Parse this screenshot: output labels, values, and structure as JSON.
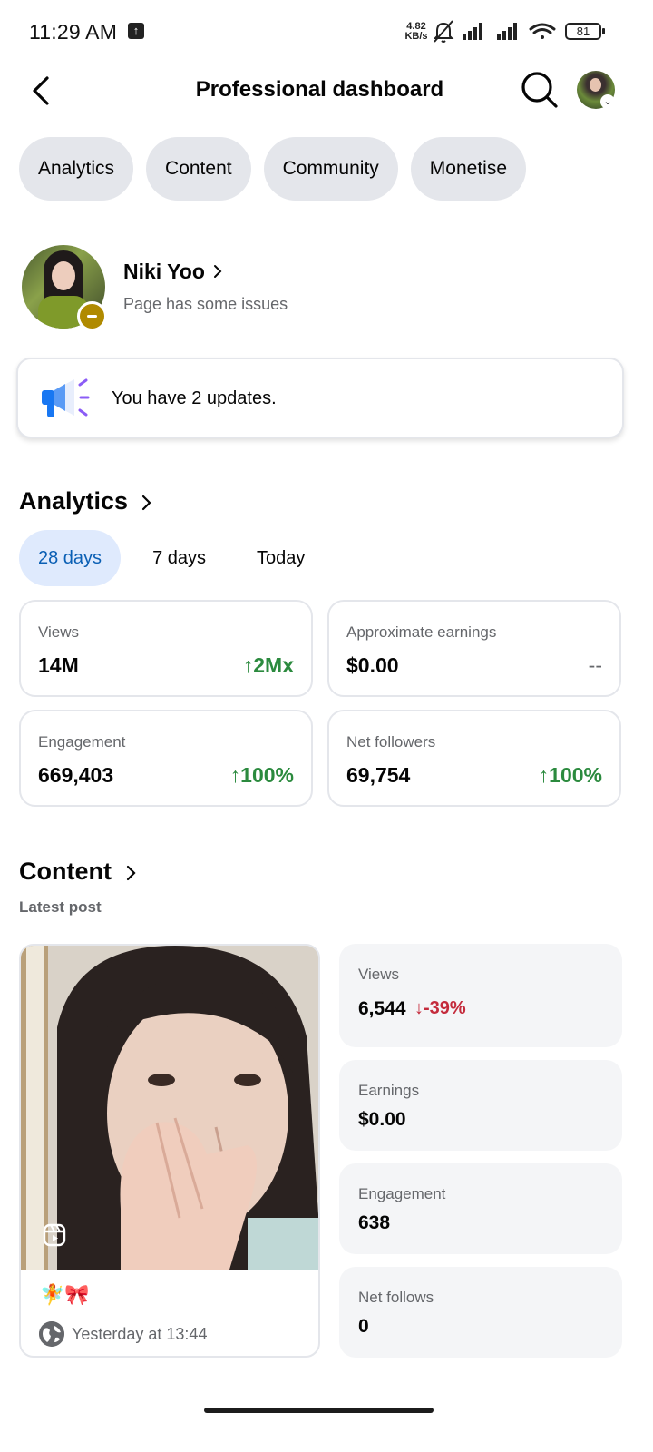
{
  "status_bar": {
    "time": "11:29 AM",
    "net_speed_value": "4.82",
    "net_speed_unit": "KB/s",
    "battery": "81",
    "icons": [
      "upload-icon",
      "mute-icon",
      "signal-icon",
      "signal-icon",
      "wifi-icon",
      "battery-icon"
    ]
  },
  "header": {
    "title": "Professional dashboard",
    "back_icon": "chevron-left-icon",
    "search_icon": "search-icon"
  },
  "top_tabs": [
    "Analytics",
    "Content",
    "Community",
    "Monetise"
  ],
  "profile": {
    "name": "Niki Yoo",
    "status": "Page has some issues"
  },
  "updates": {
    "text": "You have 2 updates."
  },
  "analytics": {
    "title": "Analytics",
    "periods": [
      "28 days",
      "7 days",
      "Today"
    ],
    "active_period": "28 days",
    "metrics": {
      "views": {
        "label": "Views",
        "value": "14M",
        "change": "2Mx",
        "direction": "up"
      },
      "earnings": {
        "label": "Approximate earnings",
        "value": "$0.00",
        "change": "--",
        "direction": "none"
      },
      "engagement": {
        "label": "Engagement",
        "value": "669,403",
        "change": "100%",
        "direction": "up"
      },
      "net_followers": {
        "label": "Net followers",
        "value": "69,754",
        "change": "100%",
        "direction": "up"
      }
    }
  },
  "content": {
    "title": "Content",
    "subtitle": "Latest post",
    "post": {
      "caption_emoji": "🧚🎀",
      "time": "Yesterday at 13:44"
    },
    "stats": {
      "views": {
        "label": "Views",
        "value": "6,544",
        "change": "-39%",
        "direction": "down"
      },
      "earnings": {
        "label": "Earnings",
        "value": "$0.00"
      },
      "engagement": {
        "label": "Engagement",
        "value": "638"
      },
      "net_follows": {
        "label": "Net follows",
        "value": "0"
      }
    }
  },
  "colors": {
    "positive": "#2b8a3e",
    "negative": "#c42b3c",
    "active_tab_bg": "#dfeafd",
    "active_tab_text": "#0a5fb4",
    "pill_bg": "#e4e6eb"
  }
}
